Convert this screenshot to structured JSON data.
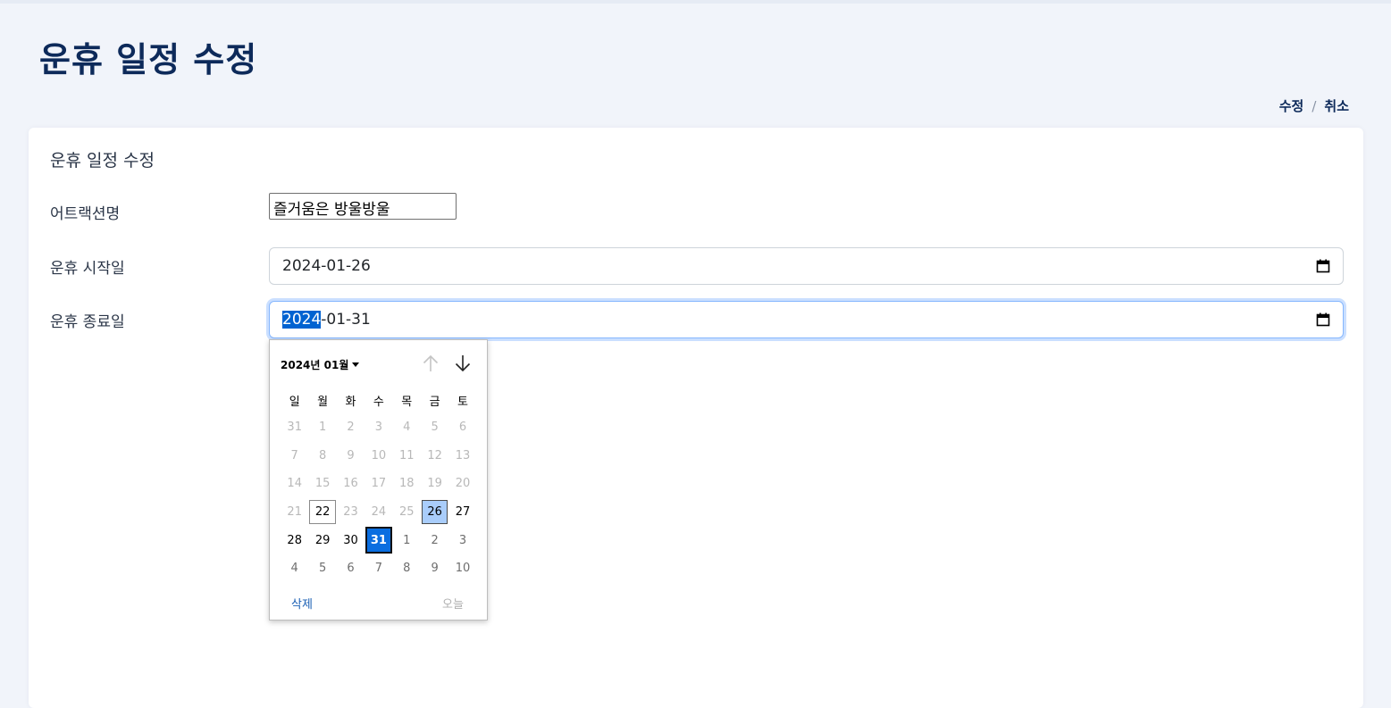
{
  "page": {
    "title": "운휴 일정 수정",
    "breadcrumb": [
      "수정",
      "취소"
    ]
  },
  "form": {
    "card_title": "운휴 일정 수정",
    "attraction_label": "어트랙션명",
    "attraction_value": "즐거움은 방울방울",
    "start_label": "운휴 시작일",
    "start_value": "2024-01-26",
    "end_label": "운휴 종료일",
    "end_value_highlighted": "2024",
    "end_value_rest": "-01-31"
  },
  "datepicker": {
    "month_label": "2024년 01월",
    "weekdays": [
      "일",
      "월",
      "화",
      "수",
      "목",
      "금",
      "토"
    ],
    "days": [
      {
        "d": "31",
        "s": "dim"
      },
      {
        "d": "1",
        "s": "dim"
      },
      {
        "d": "2",
        "s": "dim"
      },
      {
        "d": "3",
        "s": "dim"
      },
      {
        "d": "4",
        "s": "dim"
      },
      {
        "d": "5",
        "s": "dim"
      },
      {
        "d": "6",
        "s": "dim"
      },
      {
        "d": "7",
        "s": "dim"
      },
      {
        "d": "8",
        "s": "dim"
      },
      {
        "d": "9",
        "s": "dim"
      },
      {
        "d": "10",
        "s": "dim"
      },
      {
        "d": "11",
        "s": "dim"
      },
      {
        "d": "12",
        "s": "dim"
      },
      {
        "d": "13",
        "s": "dim"
      },
      {
        "d": "14",
        "s": "dim"
      },
      {
        "d": "15",
        "s": "dim"
      },
      {
        "d": "16",
        "s": "dim"
      },
      {
        "d": "17",
        "s": "dim"
      },
      {
        "d": "18",
        "s": "dim"
      },
      {
        "d": "19",
        "s": "dim"
      },
      {
        "d": "20",
        "s": "dim"
      },
      {
        "d": "21",
        "s": "dim"
      },
      {
        "d": "22",
        "s": "today"
      },
      {
        "d": "23",
        "s": "dim"
      },
      {
        "d": "24",
        "s": "dim"
      },
      {
        "d": "25",
        "s": "dim"
      },
      {
        "d": "26",
        "s": "range-start"
      },
      {
        "d": "27",
        "s": "normal"
      },
      {
        "d": "28",
        "s": "normal"
      },
      {
        "d": "29",
        "s": "normal"
      },
      {
        "d": "30",
        "s": "normal"
      },
      {
        "d": "31",
        "s": "selected"
      },
      {
        "d": "1",
        "s": "other"
      },
      {
        "d": "2",
        "s": "other"
      },
      {
        "d": "3",
        "s": "other"
      },
      {
        "d": "4",
        "s": "other"
      },
      {
        "d": "5",
        "s": "other"
      },
      {
        "d": "6",
        "s": "other"
      },
      {
        "d": "7",
        "s": "other"
      },
      {
        "d": "8",
        "s": "other"
      },
      {
        "d": "9",
        "s": "other"
      },
      {
        "d": "10",
        "s": "other"
      }
    ],
    "clear_label": "삭제",
    "today_label": "오늘"
  },
  "icons": {
    "calendar": "calendar-icon",
    "prev_month": "arrow-up-icon",
    "next_month": "arrow-down-icon",
    "month_dropdown": "caret-down-icon"
  },
  "colors": {
    "title": "#0d2a5a",
    "selected_day": "#0a6ee0",
    "range_start_day": "#a9cdfb",
    "focus_ring": "#86b7fe"
  }
}
